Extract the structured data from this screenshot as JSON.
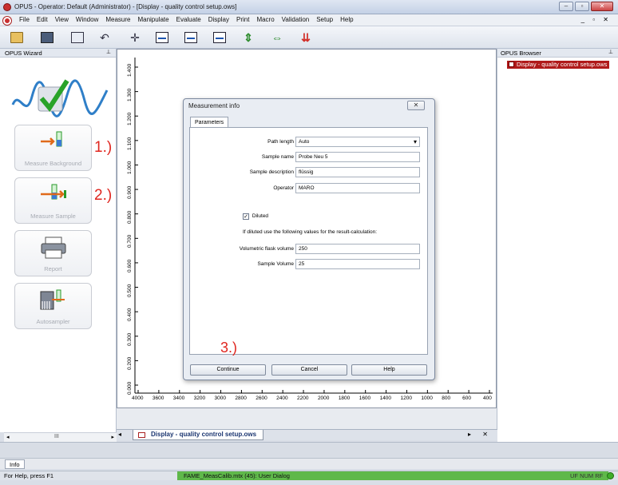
{
  "window": {
    "title": "OPUS - Operator: Default  (Administrator) - [Display - quality control setup.ows]",
    "min": "–",
    "max": "▫",
    "close": "✕"
  },
  "menu": {
    "items": [
      "File",
      "Edit",
      "View",
      "Window",
      "Measure",
      "Manipulate",
      "Evaluate",
      "Display",
      "Print",
      "Macro",
      "Validation",
      "Setup",
      "Help"
    ],
    "mdi_controls": "_ ▫ ✕"
  },
  "toolbar": {
    "icons": [
      "open-folder-icon",
      "load-icon",
      "copy-window-icon",
      "undo-icon",
      "crosshair-icon",
      "spectrum-icon",
      "spectrum-peak-icon",
      "spectrum-list-icon",
      "arrows-compress-icon",
      "arrows-expand-icon",
      "scale-arrows-icon"
    ]
  },
  "wizard": {
    "header": "OPUS Wizard",
    "pin": "📌",
    "buttons": [
      {
        "label": "Measure Background",
        "step": "1.)"
      },
      {
        "label": "Measure Sample",
        "step": "2.)"
      },
      {
        "label": "Report",
        "step": ""
      },
      {
        "label": "Autosampler",
        "step": ""
      }
    ],
    "scroll_left": "◂",
    "scroll_mid": "III",
    "scroll_right": "▸"
  },
  "plot": {
    "y_ticks": [
      "1.400",
      "1.300",
      "1.200",
      "1.100",
      "1.000",
      "0.900",
      "0.800",
      "0.700",
      "0.600",
      "0.500",
      "0.400",
      "0.300",
      "0.200",
      "0.000"
    ],
    "x_ticks": [
      "4000",
      "3600",
      "3400",
      "3200",
      "3000",
      "2800",
      "2600",
      "2400",
      "2200",
      "2000",
      "1800",
      "1600",
      "1400",
      "1200",
      "1000",
      "800",
      "600",
      "400"
    ]
  },
  "display_tab": {
    "label": "Display - quality control setup.ows",
    "left_arrow": "◂",
    "right_controls": "▸ ✕"
  },
  "browser": {
    "header": "OPUS Browser",
    "item": "Display - quality control setup.ows"
  },
  "dialog": {
    "title": "Measurement info",
    "close": "✕",
    "tab": "Parameters",
    "fields": [
      {
        "label": "Path length",
        "value": "Auto",
        "type": "select"
      },
      {
        "label": "Sample name",
        "value": "Probe Neu 5",
        "type": "text"
      },
      {
        "label": "Sample description",
        "value": "flüssig",
        "type": "text"
      },
      {
        "label": "Operator",
        "value": "MARO",
        "type": "text"
      }
    ],
    "diluted": {
      "label": "Diluted",
      "checked": "✓"
    },
    "dilution_note": "If diluted use the following values for the result-calculation:",
    "dilution_fields": [
      {
        "label": "Volumetric flask volume",
        "value": "250"
      },
      {
        "label": "Sample Volume",
        "value": "25"
      }
    ],
    "step": "3.)",
    "buttons": {
      "continue": "Continue",
      "cancel": "Cancel",
      "help": "Help"
    }
  },
  "info": {
    "tab": "Info"
  },
  "status": {
    "help": "For Help, press F1",
    "message": "FAME_MeasCalib.mtx (45): User Dialog",
    "flags": "UF NUM RF"
  }
}
